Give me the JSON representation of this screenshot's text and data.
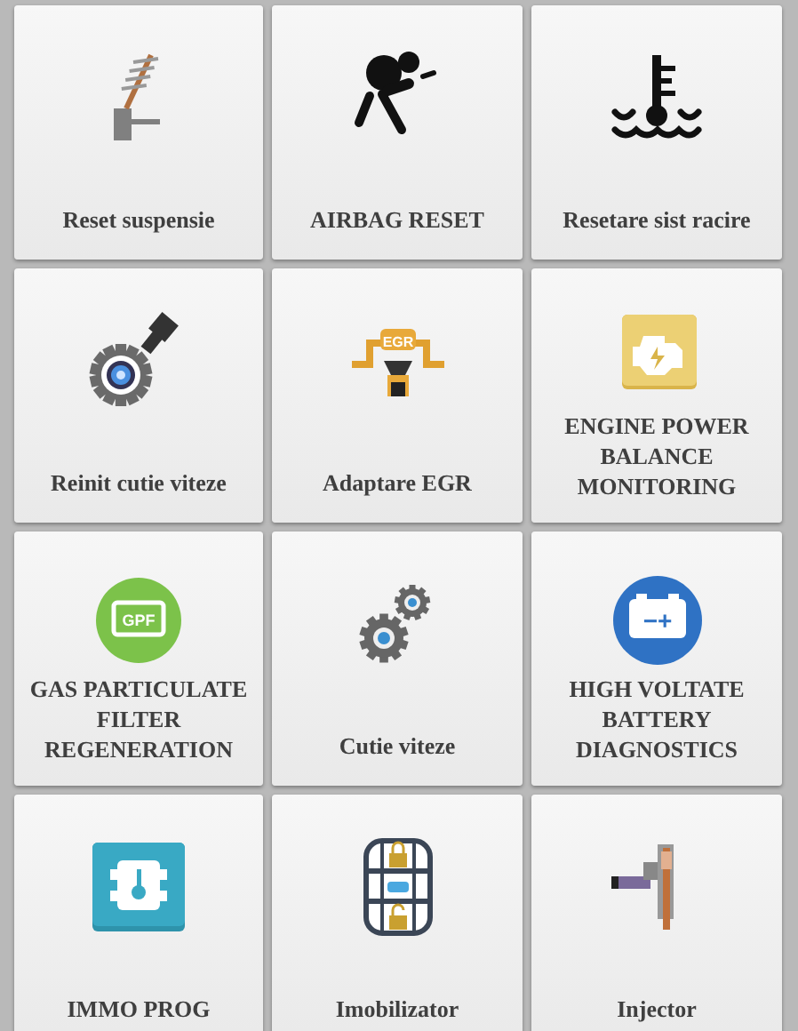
{
  "tiles": [
    {
      "label": "Reset suspensie",
      "kind": "suspension"
    },
    {
      "label": "AIRBAG RESET",
      "kind": "airbag"
    },
    {
      "label": "Resetare sist racire",
      "kind": "coolant"
    },
    {
      "label": "Reinit cutie viteze",
      "kind": "gear-plug"
    },
    {
      "label": "Adaptare EGR",
      "kind": "egr",
      "icon_text": "EGR"
    },
    {
      "label": "ENGINE POWER BALANCE MONITORING",
      "kind": "engine"
    },
    {
      "label": "GAS PARTICULATE FILTER REGENERATION",
      "kind": "gpf",
      "icon_text": "GPF"
    },
    {
      "label": "Cutie viteze",
      "kind": "gears"
    },
    {
      "label": "HIGH VOLTATE BATTERY DIAGNOSTICS",
      "kind": "battery",
      "icon_text": "−+"
    },
    {
      "label": "IMMO PROG",
      "kind": "immo"
    },
    {
      "label": "Imobilizator",
      "kind": "immobilizer"
    },
    {
      "label": "Injector",
      "kind": "injector"
    }
  ]
}
